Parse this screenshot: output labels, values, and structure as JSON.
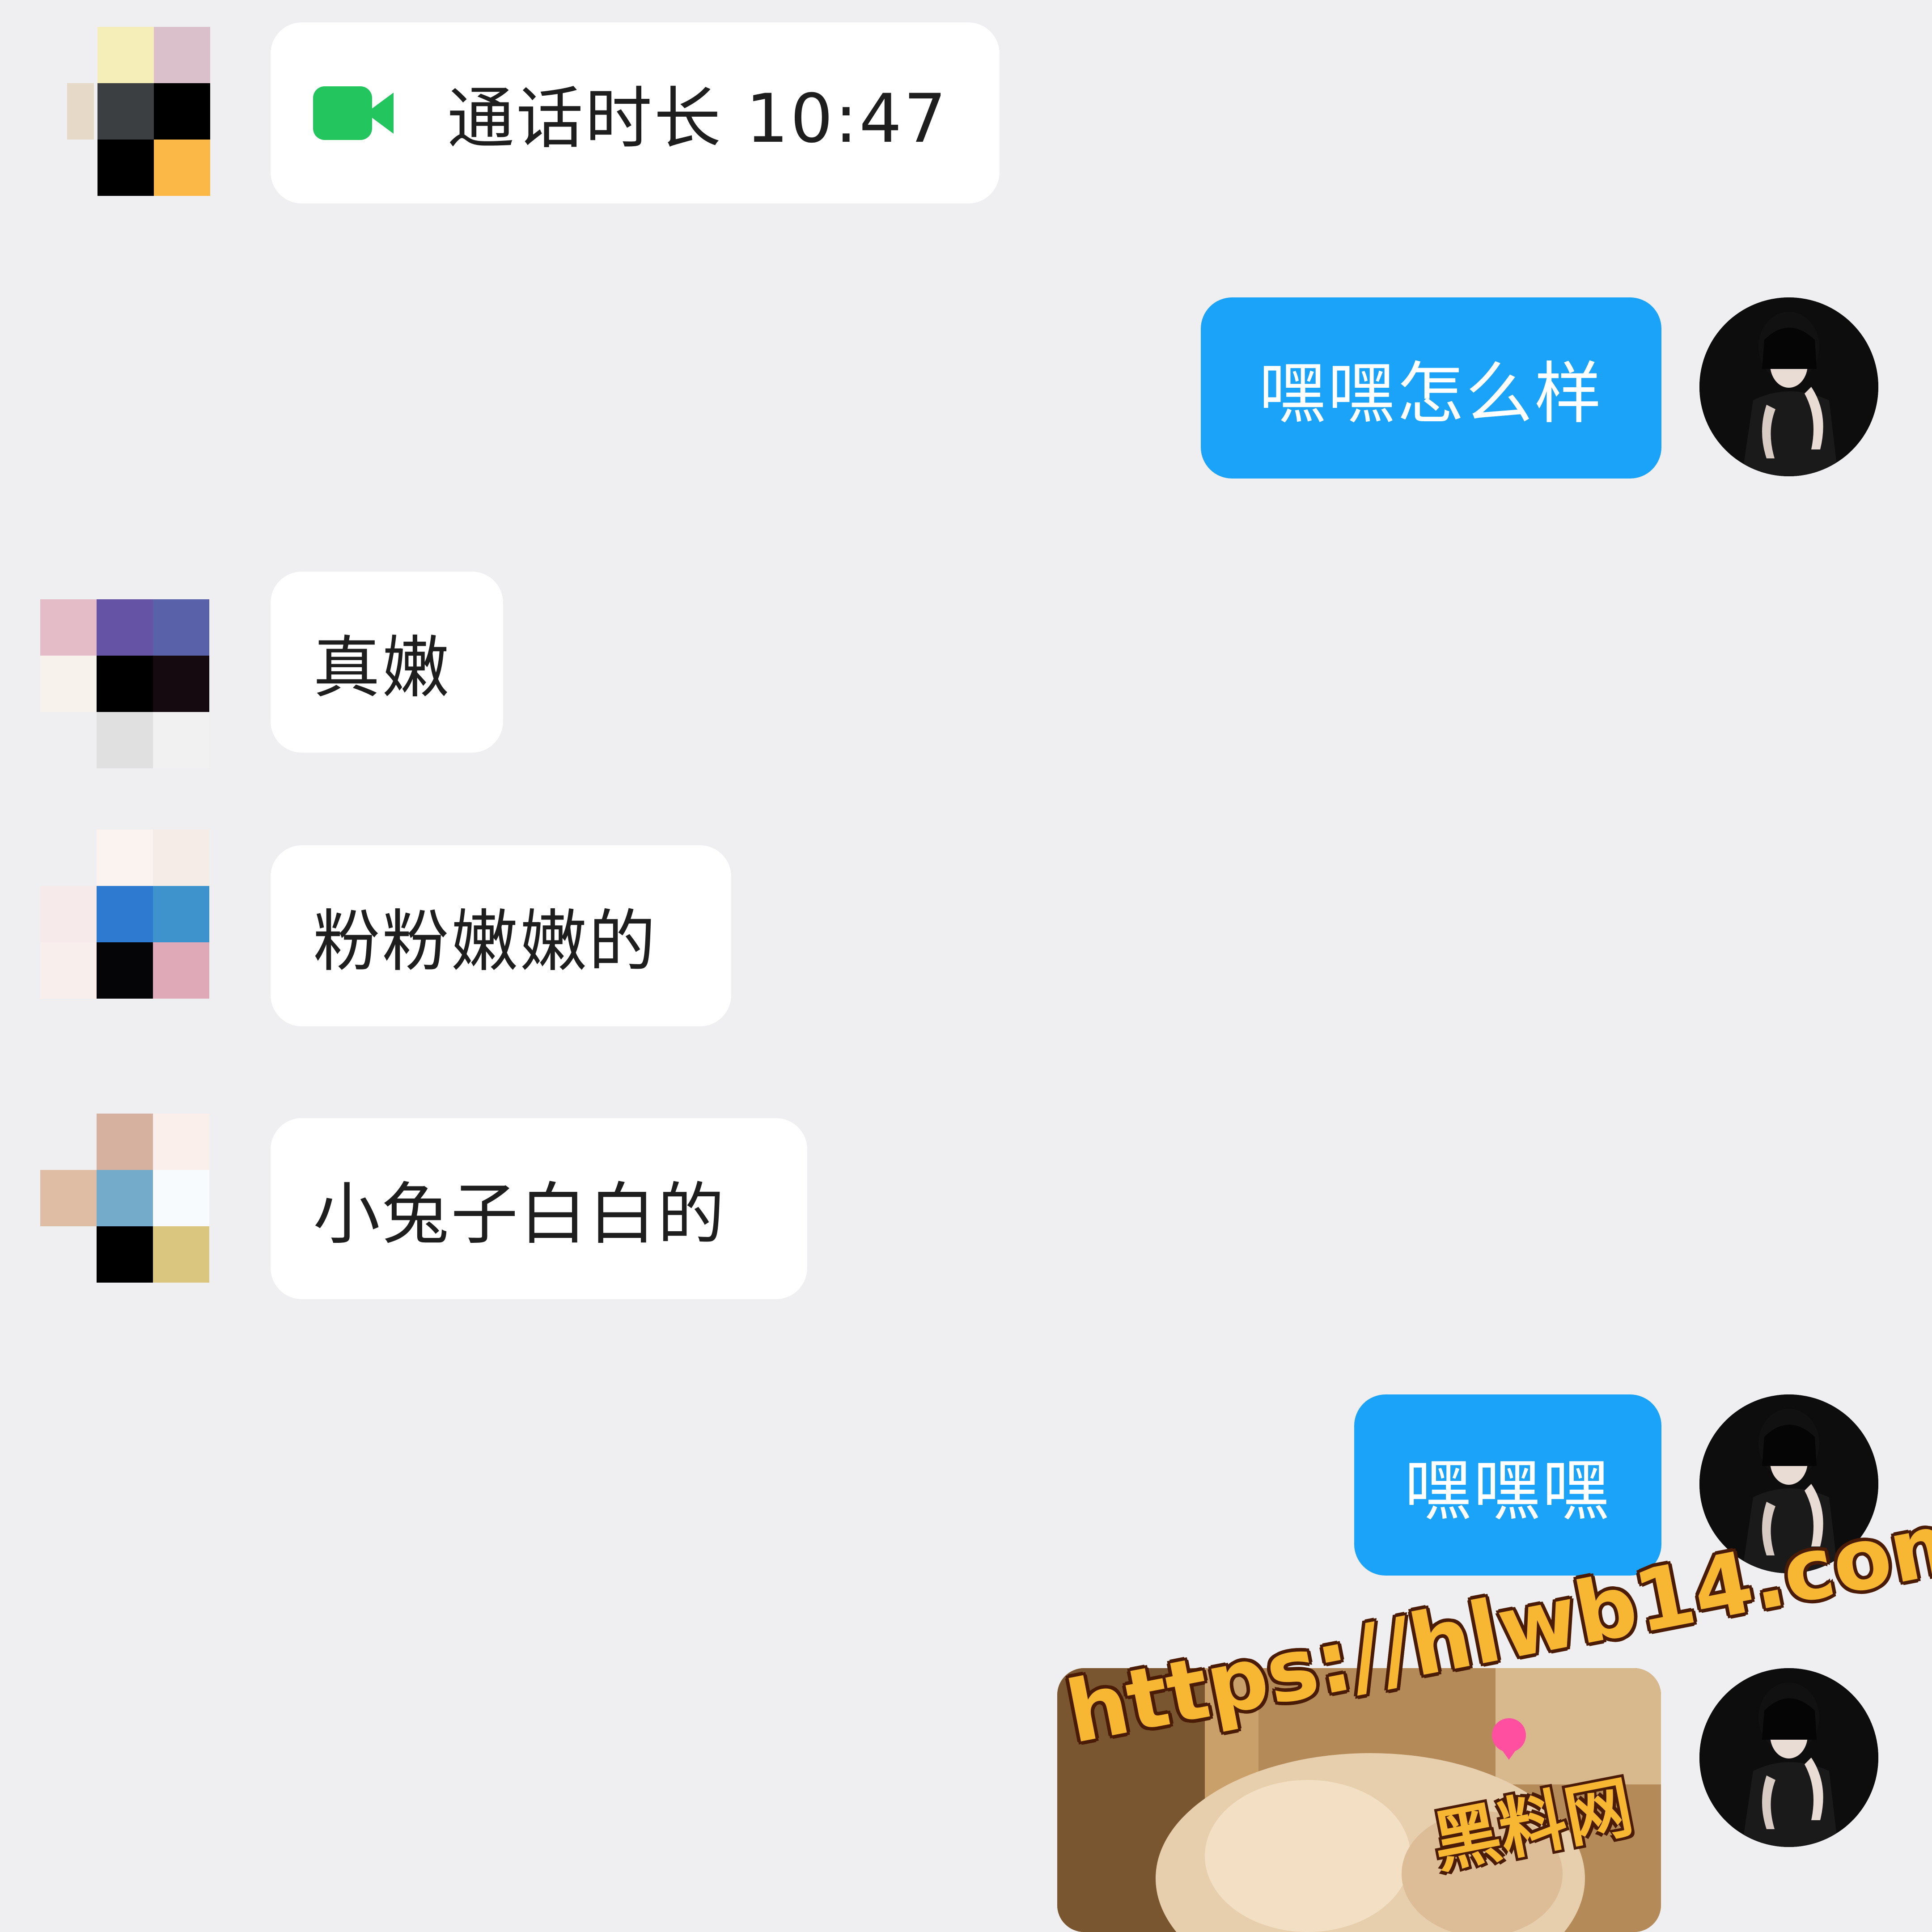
{
  "messages": {
    "call_record": {
      "text": "通话时长 10:47",
      "icon": "video-call-icon"
    },
    "msg_1": "嘿嘿怎么样",
    "msg_2": "真嫩",
    "msg_3": "粉粉嫩嫩的",
    "msg_4": "小兔子白白的",
    "msg_5": "嘿嘿嘿"
  },
  "watermark": {
    "url": "https://hlwb14.com",
    "site_name": "黑料网"
  },
  "colors": {
    "background": "#efeff1",
    "incoming_bubble": "#ffffff",
    "outgoing_bubble": "#1aa3f8",
    "call_icon": "#22c55e",
    "watermark": "#f7b733"
  }
}
